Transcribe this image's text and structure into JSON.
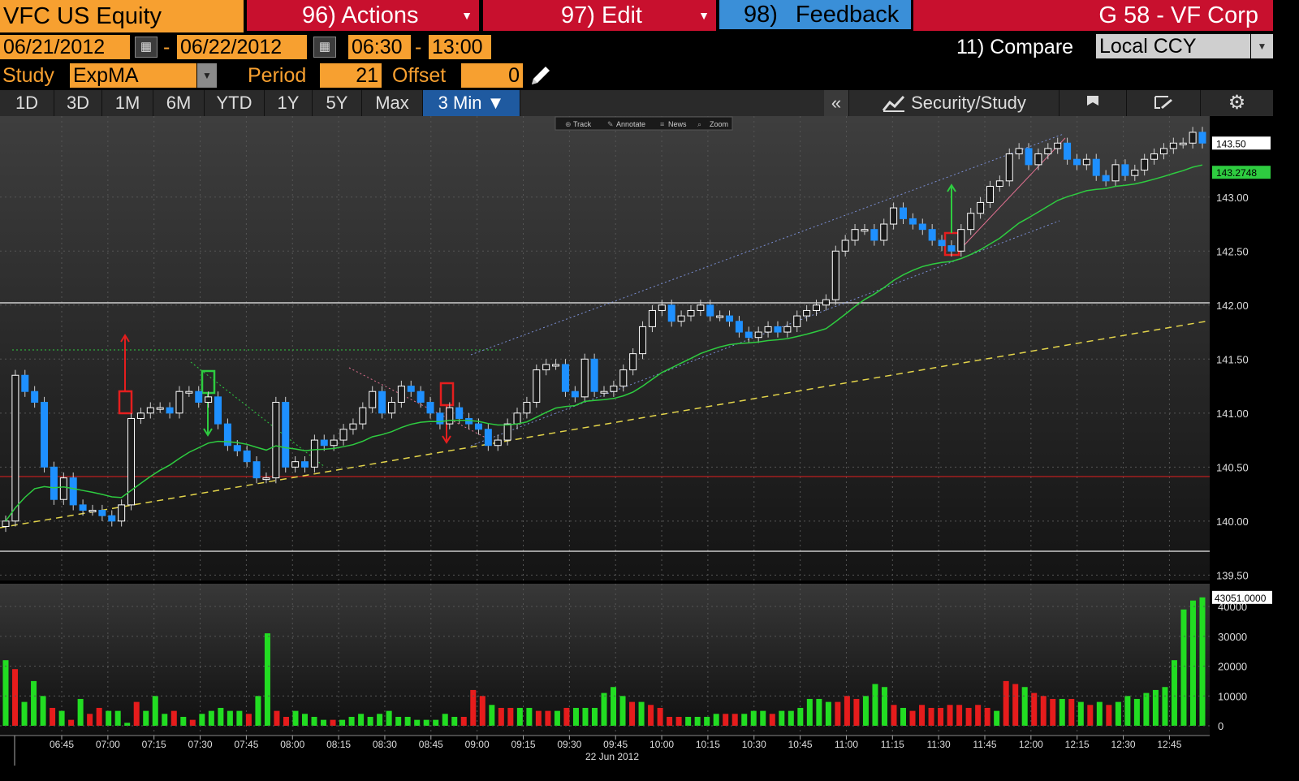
{
  "header": {
    "ticker": "VFC US Equity",
    "actions_label": "96) Actions",
    "edit_label": "97) Edit",
    "feedback_num": "98)",
    "feedback_label": "Feedback",
    "security_name": "G 58 - VF Corp"
  },
  "range": {
    "start_date": "06/21/2012",
    "end_date": "06/22/2012",
    "start_time": "06:30",
    "end_time": "13:00",
    "dash": "-",
    "compare_label": "11) Compare",
    "currency": "Local CCY"
  },
  "study": {
    "label": "Study",
    "value": "ExpMA",
    "period_label": "Period",
    "period": "21",
    "offset_label": "Offset",
    "offset": "0"
  },
  "tabs": [
    "1D",
    "3D",
    "1M",
    "6M",
    "YTD",
    "1Y",
    "5Y",
    "Max",
    "3 Min ▼"
  ],
  "toolbar": {
    "collapse": "«",
    "security_study": "Security/Study",
    "mini": [
      "Track",
      "Annotate",
      "News",
      "Zoom"
    ]
  },
  "colors": {
    "bloomberg_orange": "#f7a030",
    "header_red": "#c8102e",
    "feedback_blue": "#3a8fd8",
    "up_candle": "#ffffff",
    "down_candle": "#1e90ff",
    "ema_line": "#2ecc40",
    "volume_up": "#22dd22",
    "volume_down": "#e61c1c",
    "trendline_yellow": "#e3d44a"
  },
  "chart_data": {
    "type": "candlestick",
    "title": "",
    "date_label": "22 Jun 2012",
    "x_ticks": [
      "06:45",
      "07:00",
      "07:15",
      "07:30",
      "07:45",
      "08:00",
      "08:15",
      "08:30",
      "08:45",
      "09:00",
      "09:15",
      "09:30",
      "09:45",
      "10:00",
      "10:15",
      "10:30",
      "10:45",
      "11:00",
      "11:15",
      "11:30",
      "11:45",
      "12:00",
      "12:15",
      "12:30",
      "12:45"
    ],
    "price_ticks": [
      "143.00",
      "142.50",
      "142.00",
      "141.50",
      "141.00",
      "140.50",
      "140.00",
      "139.50"
    ],
    "ylim": [
      139.45,
      143.75
    ],
    "last_price_label": "143.50",
    "ema_label": "143.2748",
    "last_price": 143.5,
    "ema_value": 143.2748,
    "close_series": [
      140.0,
      141.35,
      141.2,
      141.1,
      140.5,
      140.2,
      140.4,
      140.15,
      140.1,
      140.1,
      140.05,
      140.0,
      140.15,
      140.95,
      141.0,
      141.05,
      141.05,
      141.0,
      141.2,
      141.2,
      141.1,
      141.15,
      140.9,
      140.7,
      140.65,
      140.55,
      140.4,
      140.4,
      141.1,
      140.5,
      140.55,
      140.5,
      140.75,
      140.7,
      140.75,
      140.85,
      140.9,
      141.05,
      141.2,
      141.0,
      141.1,
      141.25,
      141.2,
      141.1,
      141.0,
      140.9,
      141.05,
      140.95,
      140.9,
      140.85,
      140.7,
      140.75,
      140.9,
      141.0,
      141.1,
      141.4,
      141.45,
      141.45,
      141.2,
      141.15,
      141.5,
      141.2,
      141.2,
      141.25,
      141.4,
      141.55,
      141.8,
      141.95,
      142.0,
      141.85,
      141.9,
      141.95,
      142.0,
      141.9,
      141.9,
      141.85,
      141.75,
      141.7,
      141.75,
      141.8,
      141.75,
      141.8,
      141.9,
      141.95,
      142.0,
      142.05,
      142.5,
      142.6,
      142.7,
      142.7,
      142.6,
      142.75,
      142.9,
      142.8,
      142.75,
      142.7,
      142.6,
      142.55,
      142.5,
      142.7,
      142.85,
      142.95,
      143.1,
      143.15,
      143.4,
      143.45,
      143.3,
      143.4,
      143.45,
      143.5,
      143.35,
      143.3,
      143.35,
      143.2,
      143.15,
      143.3,
      143.2,
      143.25,
      143.35,
      143.4,
      143.45,
      143.5,
      143.5,
      143.6,
      143.5
    ],
    "volume_ticks": [
      "40000",
      "30000",
      "20000",
      "10000",
      "0"
    ],
    "volume_last_label": "43051.0000",
    "volume_ylim": [
      0,
      46000
    ],
    "volume_last": 43051,
    "volume_up_flags": [
      1,
      0,
      1,
      1,
      1,
      0,
      1,
      0,
      1,
      0,
      0,
      1,
      1,
      1,
      0,
      1,
      1,
      1,
      0,
      1,
      0,
      1,
      1,
      1,
      1,
      1,
      0,
      1,
      1,
      0,
      0,
      1,
      1,
      1,
      1,
      0,
      1,
      1,
      1,
      1,
      1,
      1,
      1,
      1,
      1,
      1,
      1,
      1,
      1,
      0,
      0,
      0,
      1,
      0,
      0,
      1,
      1,
      0,
      0,
      1,
      0,
      1,
      1,
      1,
      1,
      1,
      1,
      0,
      1,
      0,
      0,
      0,
      0,
      1,
      1,
      1,
      1,
      0,
      0,
      1,
      1,
      1,
      0,
      1,
      1,
      1,
      1,
      1,
      1,
      0,
      0,
      0,
      1,
      1,
      1,
      0,
      1,
      0,
      0,
      0,
      0,
      0,
      0,
      0,
      0,
      0,
      1,
      0,
      0,
      1,
      0,
      0,
      0,
      1,
      0,
      1,
      0,
      1,
      0,
      1,
      1,
      1,
      1,
      1,
      1,
      1,
      1,
      1,
      1
    ],
    "volume_series": [
      22000,
      19000,
      8000,
      15000,
      10000,
      6000,
      5000,
      2000,
      9000,
      4000,
      6000,
      5000,
      5000,
      1000,
      8000,
      5000,
      10000,
      4000,
      5000,
      3000,
      2000,
      4000,
      5000,
      6000,
      5000,
      5000,
      4000,
      10000,
      31000,
      5000,
      3000,
      5000,
      4000,
      3000,
      2000,
      2000,
      2000,
      3000,
      4000,
      3000,
      4000,
      5000,
      3000,
      3000,
      2000,
      2000,
      2000,
      4000,
      3000,
      3000,
      12000,
      10000,
      7000,
      6000,
      6000,
      6000,
      6000,
      5000,
      5000,
      5000,
      6000,
      6000,
      6000,
      6000,
      11000,
      13000,
      10000,
      8000,
      8000,
      7000,
      6000,
      3000,
      3000,
      3000,
      3000,
      3000,
      4000,
      4000,
      4000,
      4000,
      5000,
      5000,
      4000,
      5000,
      5000,
      6000,
      9000,
      9000,
      8000,
      8000,
      10000,
      9000,
      10000,
      14000,
      13000,
      7000,
      6000,
      5000,
      7000,
      6000,
      6000,
      7000,
      7000,
      6000,
      7000,
      6000,
      5000,
      15000,
      14000,
      13000,
      11000,
      10000,
      9000,
      9000,
      9000,
      8000,
      7000,
      8000,
      7000,
      8000,
      10000,
      9000,
      11000,
      12000,
      13000,
      22000,
      39000,
      42000,
      43051
    ]
  }
}
